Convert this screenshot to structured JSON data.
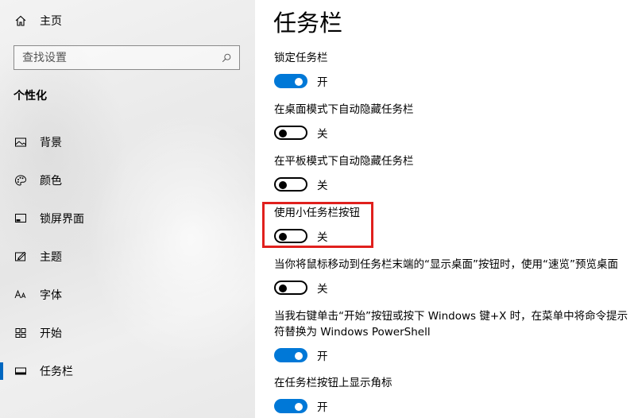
{
  "sidebar": {
    "home_label": "主页",
    "search_placeholder": "查找设置",
    "section_title": "个性化",
    "items": [
      {
        "label": "背景",
        "icon": "picture-icon"
      },
      {
        "label": "颜色",
        "icon": "palette-icon"
      },
      {
        "label": "锁屏界面",
        "icon": "lock-screen-icon"
      },
      {
        "label": "主题",
        "icon": "theme-brush-icon"
      },
      {
        "label": "字体",
        "icon": "font-icon"
      },
      {
        "label": "开始",
        "icon": "start-grid-icon"
      },
      {
        "label": "任务栏",
        "icon": "taskbar-icon",
        "active": true
      }
    ]
  },
  "main": {
    "title": "任务栏",
    "settings": [
      {
        "label": "锁定任务栏",
        "state": "开",
        "on": true
      },
      {
        "label": "在桌面模式下自动隐藏任务栏",
        "state": "关",
        "on": false
      },
      {
        "label": "在平板模式下自动隐藏任务栏",
        "state": "关",
        "on": false
      },
      {
        "label": "使用小任务栏按钮",
        "state": "关",
        "on": false,
        "highlighted": true
      },
      {
        "label": "当你将鼠标移动到任务栏末端的“显示桌面”按钮时，使用“速览”预览桌面",
        "state": "关",
        "on": false
      },
      {
        "label": "当我右键单击“开始”按钮或按下 Windows 键+X 时，在菜单中将命令提示符替换为 Windows PowerShell",
        "state": "开",
        "on": true
      },
      {
        "label": "在任务栏按钮上显示角标",
        "state": "开",
        "on": true
      }
    ]
  },
  "colors": {
    "accent": "#0078d7",
    "highlight_box": "#e0201d"
  }
}
